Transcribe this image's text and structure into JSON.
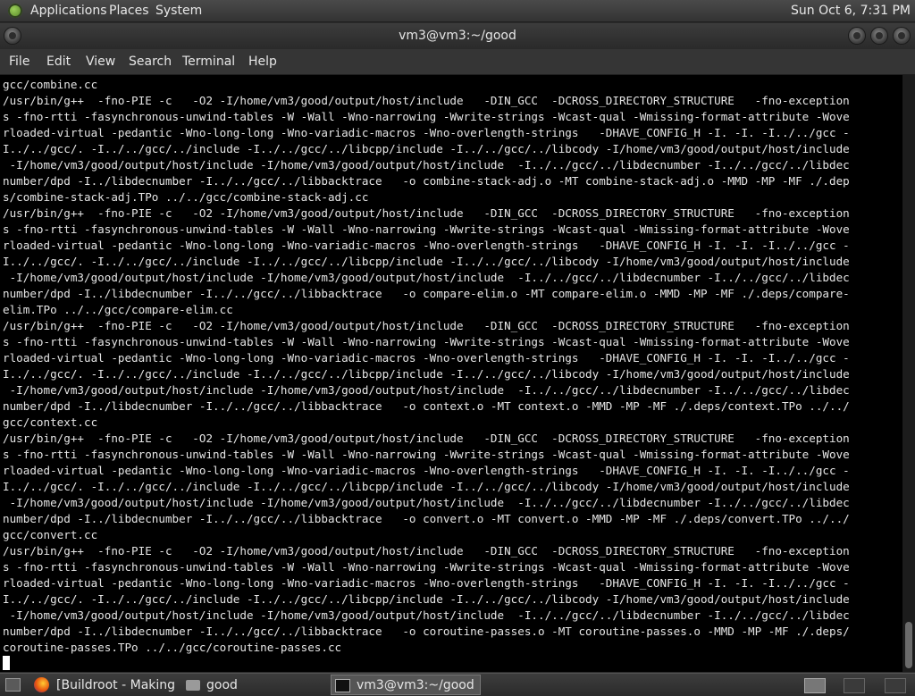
{
  "top_panel": {
    "menus": [
      "Applications",
      "Places",
      "System"
    ],
    "clock": "Sun Oct  6,  7:31 PM"
  },
  "window": {
    "title": "vm3@vm3:~/good"
  },
  "menubar": [
    "File",
    "Edit",
    "View",
    "Search",
    "Terminal",
    "Help"
  ],
  "terminal": {
    "lines": [
      "gcc/combine.cc",
      "/usr/bin/g++  -fno-PIE -c   -O2 -I/home/vm3/good/output/host/include   -DIN_GCC  -DCROSS_DIRECTORY_STRUCTURE   -fno-exception",
      "s -fno-rtti -fasynchronous-unwind-tables -W -Wall -Wno-narrowing -Wwrite-strings -Wcast-qual -Wmissing-format-attribute -Wove",
      "rloaded-virtual -pedantic -Wno-long-long -Wno-variadic-macros -Wno-overlength-strings   -DHAVE_CONFIG_H -I. -I. -I../../gcc -",
      "I../../gcc/. -I../../gcc/../include -I../../gcc/../libcpp/include -I../../gcc/../libcody -I/home/vm3/good/output/host/include",
      " -I/home/vm3/good/output/host/include -I/home/vm3/good/output/host/include  -I../../gcc/../libdecnumber -I../../gcc/../libdec",
      "number/dpd -I../libdecnumber -I../../gcc/../libbacktrace   -o combine-stack-adj.o -MT combine-stack-adj.o -MMD -MP -MF ./.dep",
      "s/combine-stack-adj.TPo ../../gcc/combine-stack-adj.cc",
      "/usr/bin/g++  -fno-PIE -c   -O2 -I/home/vm3/good/output/host/include   -DIN_GCC  -DCROSS_DIRECTORY_STRUCTURE   -fno-exception",
      "s -fno-rtti -fasynchronous-unwind-tables -W -Wall -Wno-narrowing -Wwrite-strings -Wcast-qual -Wmissing-format-attribute -Wove",
      "rloaded-virtual -pedantic -Wno-long-long -Wno-variadic-macros -Wno-overlength-strings   -DHAVE_CONFIG_H -I. -I. -I../../gcc -",
      "I../../gcc/. -I../../gcc/../include -I../../gcc/../libcpp/include -I../../gcc/../libcody -I/home/vm3/good/output/host/include",
      " -I/home/vm3/good/output/host/include -I/home/vm3/good/output/host/include  -I../../gcc/../libdecnumber -I../../gcc/../libdec",
      "number/dpd -I../libdecnumber -I../../gcc/../libbacktrace   -o compare-elim.o -MT compare-elim.o -MMD -MP -MF ./.deps/compare-",
      "elim.TPo ../../gcc/compare-elim.cc",
      "/usr/bin/g++  -fno-PIE -c   -O2 -I/home/vm3/good/output/host/include   -DIN_GCC  -DCROSS_DIRECTORY_STRUCTURE   -fno-exception",
      "s -fno-rtti -fasynchronous-unwind-tables -W -Wall -Wno-narrowing -Wwrite-strings -Wcast-qual -Wmissing-format-attribute -Wove",
      "rloaded-virtual -pedantic -Wno-long-long -Wno-variadic-macros -Wno-overlength-strings   -DHAVE_CONFIG_H -I. -I. -I../../gcc -",
      "I../../gcc/. -I../../gcc/../include -I../../gcc/../libcpp/include -I../../gcc/../libcody -I/home/vm3/good/output/host/include",
      " -I/home/vm3/good/output/host/include -I/home/vm3/good/output/host/include  -I../../gcc/../libdecnumber -I../../gcc/../libdec",
      "number/dpd -I../libdecnumber -I../../gcc/../libbacktrace   -o context.o -MT context.o -MMD -MP -MF ./.deps/context.TPo ../../",
      "gcc/context.cc",
      "/usr/bin/g++  -fno-PIE -c   -O2 -I/home/vm3/good/output/host/include   -DIN_GCC  -DCROSS_DIRECTORY_STRUCTURE   -fno-exception",
      "s -fno-rtti -fasynchronous-unwind-tables -W -Wall -Wno-narrowing -Wwrite-strings -Wcast-qual -Wmissing-format-attribute -Wove",
      "rloaded-virtual -pedantic -Wno-long-long -Wno-variadic-macros -Wno-overlength-strings   -DHAVE_CONFIG_H -I. -I. -I../../gcc -",
      "I../../gcc/. -I../../gcc/../include -I../../gcc/../libcpp/include -I../../gcc/../libcody -I/home/vm3/good/output/host/include",
      " -I/home/vm3/good/output/host/include -I/home/vm3/good/output/host/include  -I../../gcc/../libdecnumber -I../../gcc/../libdec",
      "number/dpd -I../libdecnumber -I../../gcc/../libbacktrace   -o convert.o -MT convert.o -MMD -MP -MF ./.deps/convert.TPo ../../",
      "gcc/convert.cc",
      "/usr/bin/g++  -fno-PIE -c   -O2 -I/home/vm3/good/output/host/include   -DIN_GCC  -DCROSS_DIRECTORY_STRUCTURE   -fno-exception",
      "s -fno-rtti -fasynchronous-unwind-tables -W -Wall -Wno-narrowing -Wwrite-strings -Wcast-qual -Wmissing-format-attribute -Wove",
      "rloaded-virtual -pedantic -Wno-long-long -Wno-variadic-macros -Wno-overlength-strings   -DHAVE_CONFIG_H -I. -I. -I../../gcc -",
      "I../../gcc/. -I../../gcc/../include -I../../gcc/../libcpp/include -I../../gcc/../libcody -I/home/vm3/good/output/host/include",
      " -I/home/vm3/good/output/host/include -I/home/vm3/good/output/host/include  -I../../gcc/../libdecnumber -I../../gcc/../libdec",
      "number/dpd -I../libdecnumber -I../../gcc/../libbacktrace   -o coroutine-passes.o -MT coroutine-passes.o -MMD -MP -MF ./.deps/",
      "coroutine-passes.TPo ../../gcc/coroutine-passes.cc"
    ]
  },
  "taskbar": {
    "items": [
      "[Buildroot - Making ...",
      "good",
      "vm3@vm3:~/good"
    ]
  }
}
